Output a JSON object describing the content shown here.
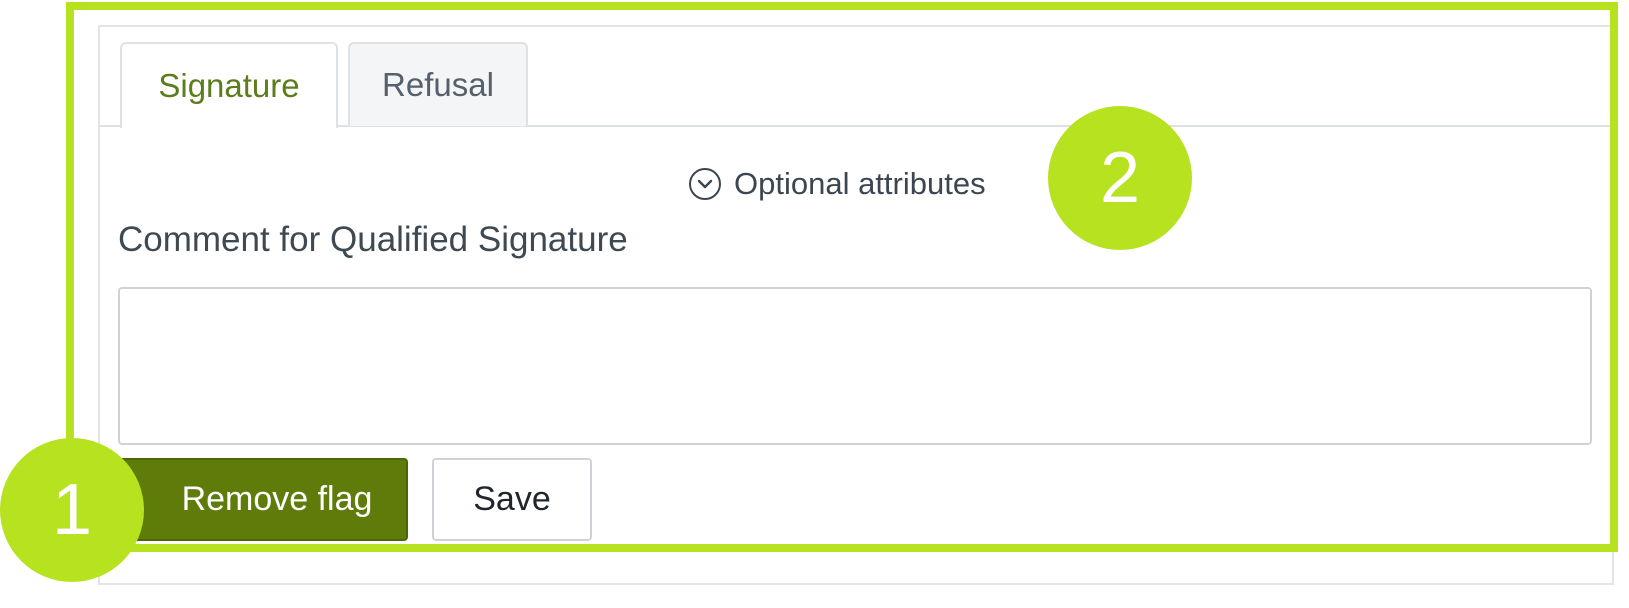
{
  "tabs": [
    {
      "label": "Signature",
      "active": true
    },
    {
      "label": "Refusal",
      "active": false
    }
  ],
  "optional_attributes": {
    "label": "Optional attributes",
    "icon": "chevron-circle-down-icon"
  },
  "comment": {
    "label": "Comment for Qualified Signature",
    "value": "",
    "placeholder": ""
  },
  "actions": {
    "remove_flag_label": "Remove flag",
    "save_label": "Save"
  },
  "callouts": {
    "badge_1": "1",
    "badge_2": "2"
  },
  "colors": {
    "highlight": "#b6e21f",
    "primary_button": "#5f7c0a",
    "active_tab_text": "#5b7d1b"
  }
}
